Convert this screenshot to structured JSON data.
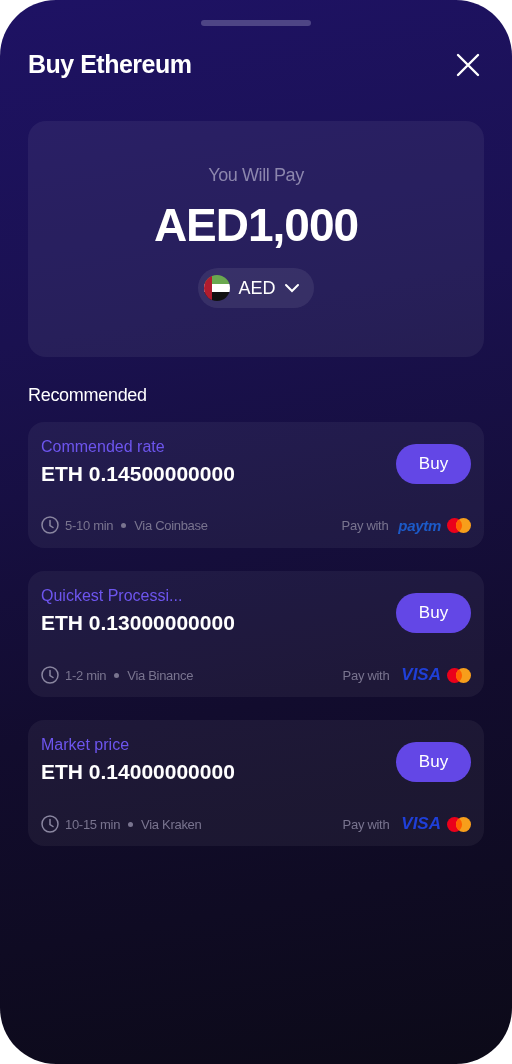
{
  "title": "Buy Ethereum",
  "pay": {
    "label": "You Will Pay",
    "amount": "AED1,000",
    "currency": "AED"
  },
  "section_title": "Recommended",
  "offers": [
    {
      "tag": "Commended rate",
      "amount": "ETH 0.14500000000",
      "time": "5-10 min",
      "via": "Via Coinbase",
      "pay_label": "Pay with",
      "method": {
        "kind": "paytm",
        "label": "paytm"
      },
      "button": "Buy"
    },
    {
      "tag": "Quickest Processi...",
      "amount": "ETH 0.13000000000",
      "time": "1-2 min",
      "via": "Via Binance",
      "pay_label": "Pay with",
      "method": {
        "kind": "visa",
        "label": "VISA"
      },
      "button": "Buy"
    },
    {
      "tag": "Market price",
      "amount": "ETH 0.14000000000",
      "time": "10-15 min",
      "via": "Via Kraken",
      "pay_label": "Pay with",
      "method": {
        "kind": "visa",
        "label": "VISA"
      },
      "button": "Buy"
    }
  ]
}
